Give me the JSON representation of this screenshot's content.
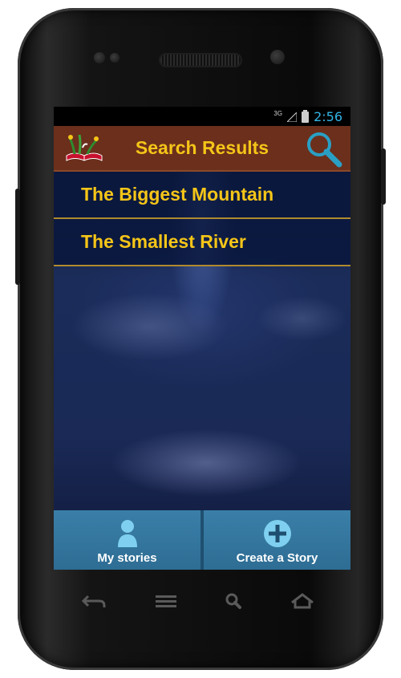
{
  "status_bar": {
    "network": "3G",
    "time": "2:56"
  },
  "header": {
    "title": "Search Results",
    "logo_icon": "book-logo-icon",
    "search_icon": "search-icon"
  },
  "results": [
    {
      "title": "The Biggest Mountain"
    },
    {
      "title": "The Smallest River"
    }
  ],
  "bottom_bar": {
    "my_stories_label": "My stories",
    "my_stories_icon": "person-icon",
    "create_story_label": "Create a Story",
    "create_story_icon": "plus-circle-icon"
  },
  "nav_buttons": [
    "back-icon",
    "menu-icon",
    "search-icon",
    "home-icon"
  ],
  "colors": {
    "header_bg": "#6b2f1c",
    "title_text": "#f5c518",
    "status_time": "#33b5e5",
    "bottom_bar": "#2e6d94"
  }
}
